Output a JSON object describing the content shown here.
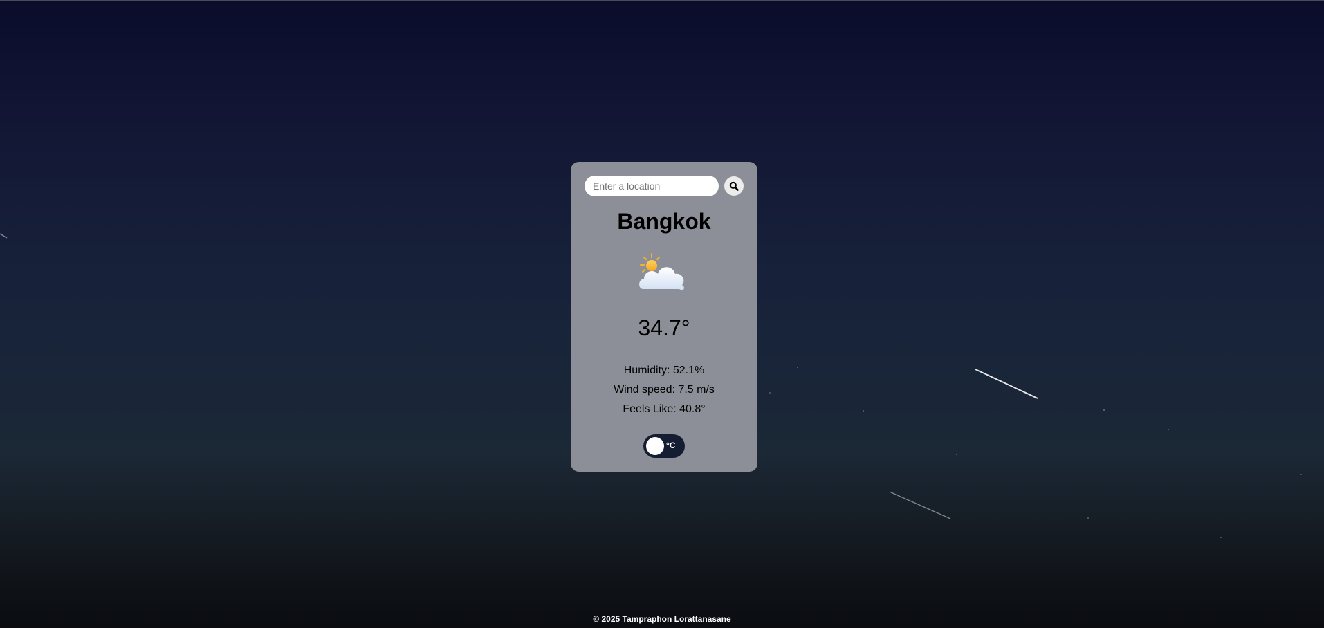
{
  "search": {
    "placeholder": "Enter a location",
    "value": "",
    "button_icon": "search-icon"
  },
  "weather": {
    "city": "Bangkok",
    "condition_icon": "partly-cloudy-icon",
    "temperature": "34.7°",
    "humidity": "Humidity: 52.1%",
    "wind_speed": "Wind speed: 7.5 m/s",
    "feels_like": "Feels Like: 40.8°"
  },
  "unit_toggle": {
    "label": "°C"
  },
  "footer": {
    "text": "© 2025 Tampraphon Lorattanasane"
  },
  "colors": {
    "card_background": "#8c8f97",
    "toggle_background": "#141d32",
    "sky_top": "#0b0c2c",
    "sky_bottom": "#0a0c10"
  }
}
